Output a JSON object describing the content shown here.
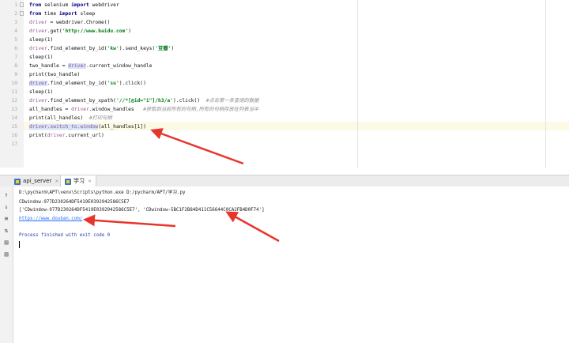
{
  "editor": {
    "lines": [
      [
        {
          "t": "from",
          "c": "kw"
        },
        {
          "t": " selenium "
        },
        {
          "t": "import",
          "c": "kw"
        },
        {
          "t": " webdriver"
        }
      ],
      [
        {
          "t": "from",
          "c": "kw"
        },
        {
          "t": " time "
        },
        {
          "t": "import",
          "c": "kw"
        },
        {
          "t": " sleep"
        }
      ],
      [
        {
          "t": "driver",
          "c": "var"
        },
        {
          "t": " = webdriver.Chrome()"
        }
      ],
      [
        {
          "t": "driver",
          "c": "var"
        },
        {
          "t": ".get("
        },
        {
          "t": "'http://www.baidu.com'",
          "c": "str"
        },
        {
          "t": ")"
        }
      ],
      [
        {
          "t": "sleep(1)"
        }
      ],
      [
        {
          "t": "driver",
          "c": "var"
        },
        {
          "t": ".find_element_by_id("
        },
        {
          "t": "'kw'",
          "c": "str"
        },
        {
          "t": ").send_keys("
        },
        {
          "t": "'豆瓣'",
          "c": "str"
        },
        {
          "t": ")"
        }
      ],
      [
        {
          "t": "sleep(1)"
        }
      ],
      [
        {
          "t": "two_handle = "
        },
        {
          "t": "driver",
          "c": "var hl"
        },
        {
          "t": ".current_window_handle"
        }
      ],
      [
        {
          "t": "print(two_handle)"
        }
      ],
      [
        {
          "t": "driver",
          "c": "var hl"
        },
        {
          "t": ".find_element_by_id("
        },
        {
          "t": "'su'",
          "c": "str"
        },
        {
          "t": ").click()"
        }
      ],
      [
        {
          "t": "sleep(1)"
        }
      ],
      [
        {
          "t": "driver",
          "c": "var"
        },
        {
          "t": ".find_element_by_xpath("
        },
        {
          "t": "'//*[@id=\"1\"]/h3/a'",
          "c": "str"
        },
        {
          "t": ").click()  "
        },
        {
          "t": "#点击第一条查询的数据",
          "c": "cm"
        }
      ],
      [
        {
          "t": "all_handles = "
        },
        {
          "t": "driver",
          "c": "var"
        },
        {
          "t": ".window_handles   "
        },
        {
          "t": "#获取到当前所有的句柄,所有的句柄存放在列表当中",
          "c": "cm"
        }
      ],
      [
        {
          "t": "print(all_handles)  "
        },
        {
          "t": "#打印句柄",
          "c": "cm"
        }
      ],
      [
        {
          "t": "driver.switch_to.window",
          "c": "var hl"
        },
        {
          "t": "(all_handles[1])"
        }
      ],
      [
        {
          "t": "print("
        },
        {
          "t": "driver",
          "c": "var"
        },
        {
          "t": ".current_url)"
        }
      ],
      []
    ]
  },
  "run_tabs": [
    {
      "label": "api_server",
      "icon": "python-file-icon",
      "active": false
    },
    {
      "label": "学习",
      "icon": "python-file-icon",
      "active": true
    }
  ],
  "console": {
    "command": "D:\\pycharm\\APT\\venv\\Scripts\\python.exe D:/pycharm/APT/学习.py",
    "handle_line": "CDwindow-977D230264DF5419E0392942586C5E7",
    "handles_list": "['CDwindow-977D230264DF5419E0392942586C5E7', 'CDwindow-5BC1F2B84D411C56644C0CA2FB4D0F74']",
    "url_line": "https://www.douban.com/",
    "exit_line": "Process finished with exit code 0"
  },
  "tool_icons": [
    "up-arrow-icon",
    "down-arrow-icon",
    "wrap-icon",
    "sort-icon",
    "print-icon",
    "trash-icon"
  ],
  "colors": {
    "annotation_arrow": "#e8352c",
    "keyword": "#000080",
    "variable": "#94558d",
    "string": "#067d17",
    "comment": "#8c8c8c",
    "link": "#2470ff"
  }
}
